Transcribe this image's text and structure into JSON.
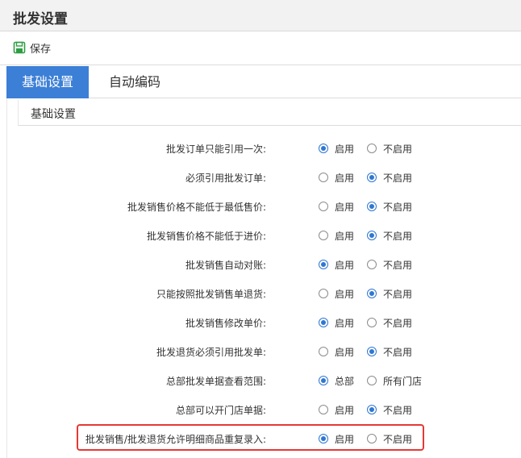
{
  "page_title": "批发设置",
  "toolbar": {
    "save_label": "保存"
  },
  "tabs": [
    {
      "label": "基础设置",
      "active": true
    },
    {
      "label": "自动编码",
      "active": false
    }
  ],
  "section_title": "基础设置",
  "accent_color": "#3c7fd6",
  "highlight_color": "#e53935",
  "settings": [
    {
      "label": "批发订单只能引用一次:",
      "opt1": "启用",
      "opt2": "不启用",
      "selected": 1
    },
    {
      "label": "必须引用批发订单:",
      "opt1": "启用",
      "opt2": "不启用",
      "selected": 2
    },
    {
      "label": "批发销售价格不能低于最低售价:",
      "opt1": "启用",
      "opt2": "不启用",
      "selected": 2
    },
    {
      "label": "批发销售价格不能低于进价:",
      "opt1": "启用",
      "opt2": "不启用",
      "selected": 2
    },
    {
      "label": "批发销售自动对账:",
      "opt1": "启用",
      "opt2": "不启用",
      "selected": 1
    },
    {
      "label": "只能按照批发销售单退货:",
      "opt1": "启用",
      "opt2": "不启用",
      "selected": 2
    },
    {
      "label": "批发销售修改单价:",
      "opt1": "启用",
      "opt2": "不启用",
      "selected": 1
    },
    {
      "label": "批发退货必须引用批发单:",
      "opt1": "启用",
      "opt2": "不启用",
      "selected": 2
    },
    {
      "label": "总部批发单据查看范围:",
      "opt1": "总部",
      "opt2": "所有门店",
      "selected": 1
    },
    {
      "label": "总部可以开门店单据:",
      "opt1": "启用",
      "opt2": "不启用",
      "selected": 2
    },
    {
      "label": "批发销售/批发退货允许明细商品重复录入:",
      "opt1": "启用",
      "opt2": "不启用",
      "selected": 1,
      "highlighted": true
    }
  ]
}
